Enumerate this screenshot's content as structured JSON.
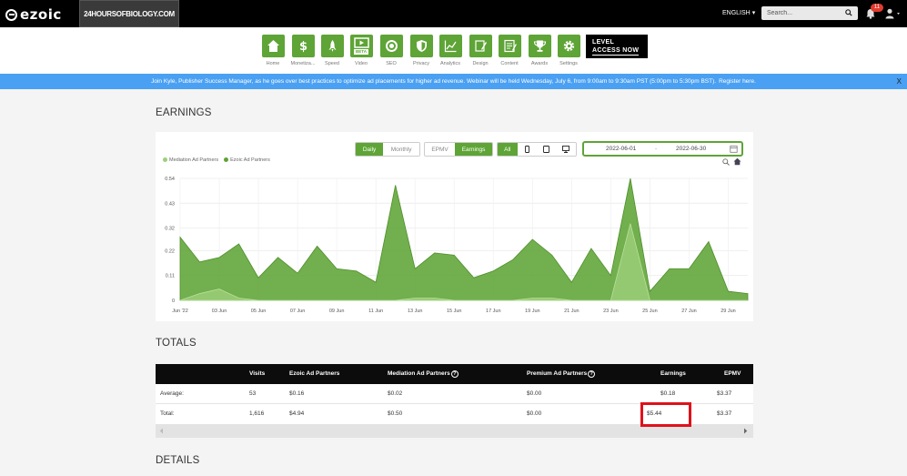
{
  "topbar": {
    "logo_text": "ezoic",
    "site": "24HOURSOFBIOLOGY.COM",
    "language": "ENGLISH",
    "search_placeholder": "Search...",
    "notifications": "11"
  },
  "nav": {
    "items": [
      {
        "label": "Home",
        "icon": "home-icon"
      },
      {
        "label": "Monetiza...",
        "icon": "dollar-icon"
      },
      {
        "label": "Speed",
        "icon": "rocket-icon"
      },
      {
        "label": "Video",
        "icon": "video-icon"
      },
      {
        "label": "SEO",
        "icon": "magnifier-icon"
      },
      {
        "label": "Privacy",
        "icon": "shield-icon"
      },
      {
        "label": "Analytics",
        "icon": "analytics-icon"
      },
      {
        "label": "Design",
        "icon": "design-icon"
      },
      {
        "label": "Content",
        "icon": "content-icon"
      },
      {
        "label": "Awards",
        "icon": "trophy-icon"
      },
      {
        "label": "Settings",
        "icon": "gear-icon"
      }
    ],
    "video_badge": "BETA",
    "level_access_line1": "LEVEL",
    "level_access_line2": "ACCESS NOW"
  },
  "banner": {
    "text": "Join Kyle, Publisher Success Manager, as he goes over best practices to optimize ad placements for higher ad revenue. Webinar will be held Wednesday, July 6, from 9:00am to 9:30am PST (5:00pm to 5:30pm BST).",
    "link": "Register here.",
    "close": "X"
  },
  "earnings": {
    "title": "EARNINGS",
    "period_buttons": {
      "daily": "Daily",
      "monthly": "Monthly"
    },
    "metric_buttons": {
      "epmv": "EPMV",
      "earnings": "Earnings"
    },
    "device_buttons": {
      "all": "All"
    },
    "date_start": "2022-06-01",
    "date_sep": "-",
    "date_end": "2022-06-30"
  },
  "chart_data": {
    "type": "area",
    "title": "",
    "xlabel": "",
    "ylabel": "",
    "ylim": [
      0,
      0.54
    ],
    "yticks": [
      0,
      0.11,
      0.22,
      0.32,
      0.43,
      0.54
    ],
    "ytick_labels": [
      "0",
      "0.11",
      "0.22",
      "0.32",
      "0.43",
      "0.54"
    ],
    "xtick_labels": [
      "Jun '22",
      "03 Jun",
      "05 Jun",
      "07 Jun",
      "09 Jun",
      "11 Jun",
      "13 Jun",
      "15 Jun",
      "17 Jun",
      "19 Jun",
      "21 Jun",
      "23 Jun",
      "25 Jun",
      "27 Jun",
      "29 Jun"
    ],
    "legend_position": "top-left",
    "grid": true,
    "x": [
      "2022-06-01",
      "2022-06-02",
      "2022-06-03",
      "2022-06-04",
      "2022-06-05",
      "2022-06-06",
      "2022-06-07",
      "2022-06-08",
      "2022-06-09",
      "2022-06-10",
      "2022-06-11",
      "2022-06-12",
      "2022-06-13",
      "2022-06-14",
      "2022-06-15",
      "2022-06-16",
      "2022-06-17",
      "2022-06-18",
      "2022-06-19",
      "2022-06-20",
      "2022-06-21",
      "2022-06-22",
      "2022-06-23",
      "2022-06-24",
      "2022-06-25",
      "2022-06-26",
      "2022-06-27",
      "2022-06-28",
      "2022-06-29",
      "2022-06-30"
    ],
    "series": [
      {
        "name": "Mediation Ad Partners",
        "color": "#9ccf7a",
        "values": [
          0,
          0.03,
          0.05,
          0.01,
          0,
          0,
          0,
          0,
          0,
          0,
          0,
          0,
          0.01,
          0.01,
          0,
          0,
          0,
          0,
          0.01,
          0.01,
          0,
          0,
          0,
          0.34,
          0,
          0,
          0,
          0,
          0,
          0
        ]
      },
      {
        "name": "Ezoic Ad Partners",
        "color": "#5ea436",
        "values": [
          0.28,
          0.17,
          0.19,
          0.25,
          0.1,
          0.19,
          0.12,
          0.24,
          0.14,
          0.13,
          0.08,
          0.51,
          0.14,
          0.21,
          0.2,
          0.1,
          0.13,
          0.18,
          0.27,
          0.2,
          0.08,
          0.23,
          0.11,
          0.54,
          0.04,
          0.14,
          0.14,
          0.26,
          0.04,
          0.03
        ]
      }
    ]
  },
  "totals": {
    "title": "TOTALS",
    "columns": [
      "",
      "Visits",
      "Ezoic Ad Partners",
      "Mediation Ad Partners",
      "Premium Ad Partners",
      "Earnings",
      "EPMV"
    ],
    "rows": [
      [
        "Average:",
        "53",
        "$0.16",
        "$0.02",
        "$0.00",
        "$0.18",
        "$3.37"
      ],
      [
        "Total:",
        "1,616",
        "$4.94",
        "$0.50",
        "$0.00",
        "$5.44",
        "$3.37"
      ]
    ]
  },
  "details": {
    "title": "DETAILS"
  }
}
